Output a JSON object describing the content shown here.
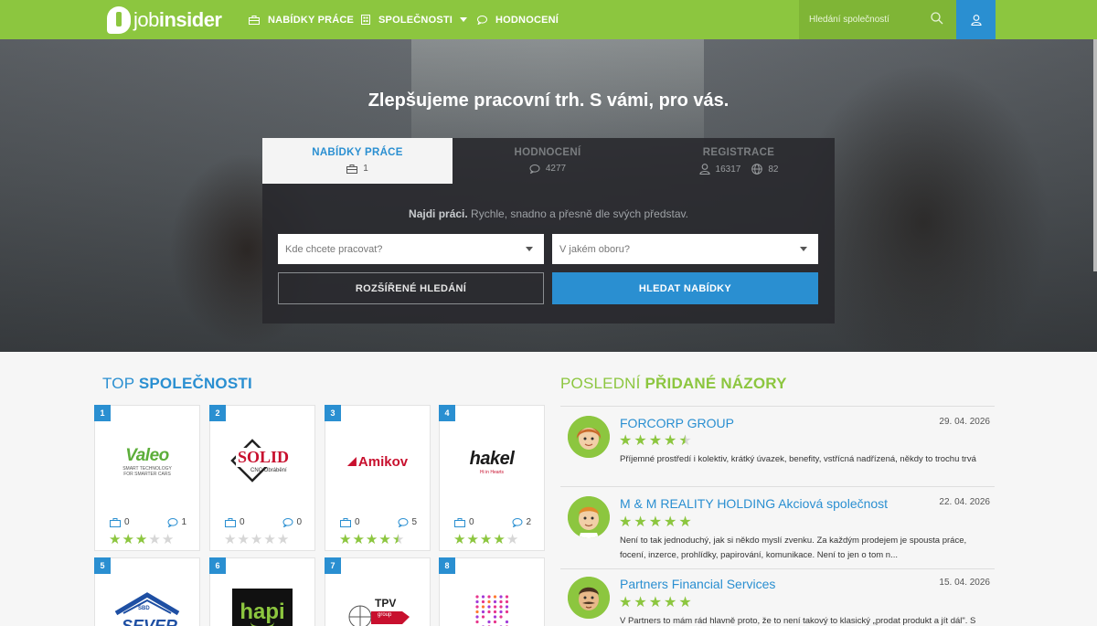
{
  "brand": {
    "name_light": "job",
    "name_bold": "insider"
  },
  "nav": [
    {
      "label": "NABÍDKY PRÁCE",
      "icon": "briefcase-icon"
    },
    {
      "label": "SPOLEČNOSTI",
      "icon": "building-icon",
      "has_dropdown": true
    },
    {
      "label": "HODNOCENÍ",
      "icon": "speech-bubble-icon"
    }
  ],
  "search": {
    "placeholder": "Hledání společností"
  },
  "colors": {
    "green": "#8cc63f",
    "blue": "#2a8fd1"
  },
  "hero": {
    "title": "Zlepšujeme pracovní trh. S vámi, pro vás.",
    "tabs": [
      {
        "label": "NABÍDKY PRÁCE",
        "count": "1",
        "active": true
      },
      {
        "label": "HODNOCENÍ",
        "count": "4277",
        "active": false
      },
      {
        "label": "REGISTRACE",
        "count": "16317",
        "count2": "82",
        "active": false
      }
    ],
    "tagline_bold": "Najdi práci.",
    "tagline_rest": " Rychle, snadno a přesně dle svých představ.",
    "location_placeholder": "Kde chcete pracovat?",
    "field_placeholder": "V jakém oboru?",
    "advanced_label": "ROZŠÍŘENÉ HLEDÁNÍ",
    "search_label": "HLEDAT NABÍDKY"
  },
  "top_companies": {
    "title_light": "TOP ",
    "title_bold": "SPOLEČNOSTI",
    "items": [
      {
        "rank": "1",
        "logo": "valeo-logo",
        "logo_text": "Valeo",
        "logo_sub": "SMART TECHNOLOGY FOR SMARTER CARS",
        "jobs": "0",
        "reviews": "1",
        "rating": 3
      },
      {
        "rank": "2",
        "logo": "solid-logo",
        "logo_text": "SOLID",
        "logo_sub": "CNC Obrábění",
        "jobs": "0",
        "reviews": "0",
        "rating": 0
      },
      {
        "rank": "3",
        "logo": "amikov-logo",
        "logo_text": "Amikov",
        "logo_sub": "",
        "jobs": "0",
        "reviews": "5",
        "rating": 4.5
      },
      {
        "rank": "4",
        "logo": "hakel-logo",
        "logo_text": "hakel",
        "logo_sub": "Hi in Hearts",
        "jobs": "0",
        "reviews": "2",
        "rating": 4
      },
      {
        "rank": "5",
        "logo": "sever-logo",
        "logo_text": "SEVER",
        "logo_sub": "SBD"
      },
      {
        "rank": "6",
        "logo": "hapi-logo",
        "logo_text": "hapi"
      },
      {
        "rank": "7",
        "logo": "tpv-logo",
        "logo_text": "TPV",
        "logo_sub": "group"
      },
      {
        "rank": "8",
        "logo": "dots-logo"
      }
    ]
  },
  "latest_reviews": {
    "title_light": "POSLEDNÍ ",
    "title_bold": "PŘIDANÉ NÁZORY",
    "items": [
      {
        "company": "FORCORP GROUP",
        "date": "29. 04. 2026",
        "rating": 4.5,
        "text": "Příjemné prostředí i kolektiv, krátký úvazek, benefity, vstřícná nadřízená, někdy to trochu trvá",
        "avatar": "avatar-woman-icon"
      },
      {
        "company": "M & M REALITY HOLDING Akciová společnost",
        "date": "22. 04. 2026",
        "rating": 5,
        "text": "Není to tak jednoduchý, jak si někdo myslí zvenku. Za každým prodejem je spousta práce, focení, inzerce, prohlídky, papirování, komunikace. Není to jen o tom n...",
        "avatar": "avatar-man-icon"
      },
      {
        "company": "Partners Financial Services",
        "date": "15. 04. 2026",
        "rating": 5,
        "text": "V Partners to mám rád hlavně proto, že to není takový to klasický „prodat produkt a jít dál\". S",
        "avatar": "avatar-mustache-icon"
      }
    ]
  }
}
